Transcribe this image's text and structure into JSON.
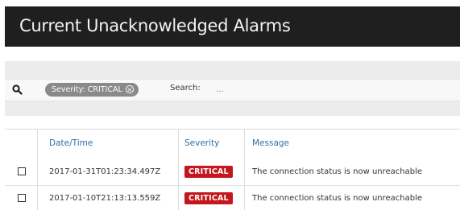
{
  "header": {
    "title": "Current Unacknowledged Alarms"
  },
  "filter": {
    "chip_label": "Severity: CRITICAL",
    "chip_clear_glyph": "×",
    "search_label": "Search:",
    "search_placeholder": "..."
  },
  "table": {
    "columns": [
      "Date/Time",
      "Severity",
      "Message"
    ],
    "rows": [
      {
        "datetime": "2017-01-31T01:23:34.497Z",
        "severity": "CRITICAL",
        "message": "The connection status is now unreachable"
      },
      {
        "datetime": "2017-01-10T21:13:13.559Z",
        "severity": "CRITICAL",
        "message": "The connection status is now unreachable"
      }
    ]
  },
  "colors": {
    "header_bg": "#1f1f1f",
    "column_header_text": "#2d6fa8",
    "critical_badge": "#c4161c",
    "chip_bg": "#8a8a8a"
  },
  "icons": {
    "search": "magnifier-icon",
    "clear": "clear-filter-icon"
  }
}
